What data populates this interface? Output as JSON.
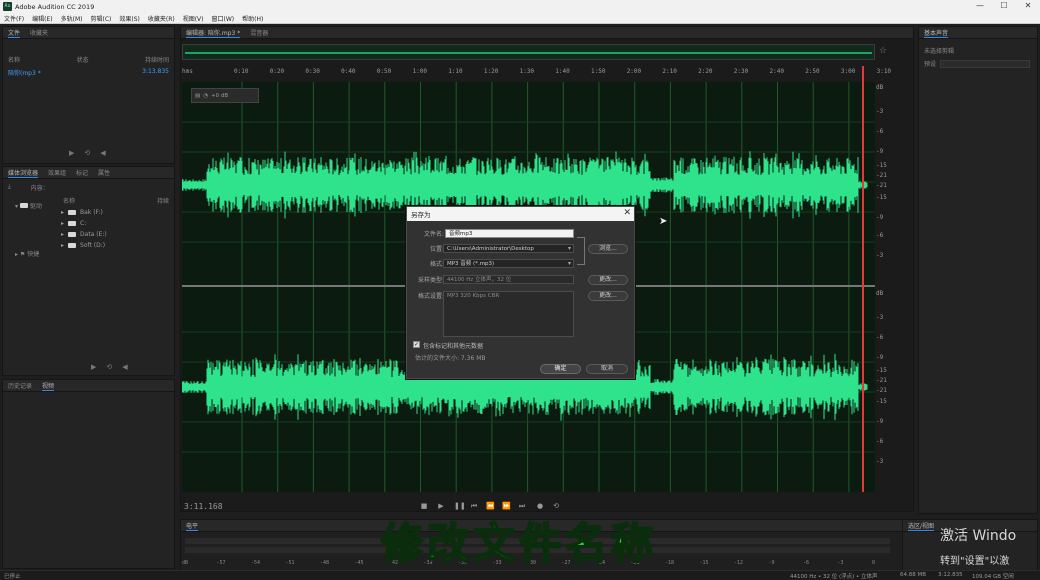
{
  "window": {
    "icon_text": "Au",
    "title": "Adobe Audition CC 2019",
    "minimize": "—",
    "maximize": "☐",
    "close": "✕"
  },
  "menu": [
    "文件(F)",
    "编辑(E)",
    "多轨(M)",
    "剪辑(C)",
    "效果(S)",
    "收藏夹(R)",
    "视图(V)",
    "窗口(W)",
    "帮助(H)"
  ],
  "files_panel": {
    "tabs": [
      "文件",
      "收藏夹"
    ],
    "column_name": "名称",
    "column_status": "状态",
    "column_duration": "持续时间",
    "file_name": "陪你(mp3 *",
    "file_duration": "3:13.835"
  },
  "media_panel": {
    "tabs": [
      "媒体浏览器",
      "效果组",
      "标记",
      "属性"
    ],
    "content_label": "内容：",
    "name_header": "名称",
    "path_header": "持续",
    "tree": [
      "驱动",
      "快捷"
    ],
    "drives": [
      "Bak (F:)",
      "C:",
      "Data (E:)",
      "Soft (D:)"
    ]
  },
  "history_panel": {
    "tabs": [
      "历史记录",
      "视频"
    ]
  },
  "editor": {
    "tabs": [
      "编辑器: 陪你.mp3 *",
      "混音器"
    ],
    "hud_level": "+0 dB",
    "ruler_unit": "hms",
    "ticks": [
      "0:10",
      "0:20",
      "0:30",
      "0:40",
      "0:50",
      "1:00",
      "1:10",
      "1:20",
      "1:30",
      "1:40",
      "1:50",
      "2:00",
      "2:10",
      "2:20",
      "2:30",
      "2:40",
      "2:50",
      "3:00",
      "3:10"
    ],
    "db_top": [
      "dB",
      "-3",
      "-6",
      "-9",
      "-15",
      "-21",
      "-21",
      "-15",
      "-9",
      "-6",
      "-3"
    ],
    "db_bottom": [
      "dB",
      "-3",
      "-6",
      "-9",
      "-15",
      "-21",
      "-21",
      "-15",
      "-9",
      "-6",
      "-3"
    ],
    "timecode": "3:11.168"
  },
  "levels_panel": {
    "tab": "电平",
    "scale": [
      "dB",
      "-57",
      "-54",
      "-51",
      "-48",
      "-45",
      "-42",
      "-39",
      "-36",
      "-33",
      "-30",
      "-27",
      "-24",
      "-21",
      "-18",
      "-15",
      "-12",
      "-9",
      "-6",
      "-3",
      "0"
    ]
  },
  "right_panels": {
    "basic_sound": "基本声音",
    "no_selection": "未选择剪辑",
    "preset_label": "预设",
    "selection_view": "选区/视图"
  },
  "status": {
    "left": "已停止",
    "sample_rate": "44100 Hz • 32 位 (浮点) • 立体声",
    "size": "64.88 MB",
    "duration": "3:12.835",
    "free": "109.04 GB 空闲"
  },
  "dialog": {
    "title": "另存为",
    "close": "✕",
    "filename_label": "文件名:",
    "filename_value": "音频mp3",
    "location_label": "位置:",
    "location_value": "C:\\Users\\Administrator\\Desktop",
    "browse_button": "浏览...",
    "format_label": "格式:",
    "format_value": "MP3 音频 (*.mp3)",
    "sample_type_label": "采样类型:",
    "sample_type_value": "44100 Hz 立体声，32 位",
    "change_button_1": "更改...",
    "format_settings_label": "格式设置:",
    "format_settings_value": "MP3 320 Kbps CBR",
    "change_button_2": "更改...",
    "include_markers": "包含标记和其他元数据",
    "estimated_size": "估计的文件大小: 7.36 MB",
    "ok_button": "确定",
    "cancel_button": "取消"
  },
  "overlay": {
    "caption": "修改文件名称",
    "watermark_line1": "激活 Windo",
    "watermark_line2": "转到\"设置\"以激"
  },
  "colors": {
    "waveform": "#2fe38c",
    "playhead": "#e03a3a",
    "caption": "#39d94a"
  }
}
